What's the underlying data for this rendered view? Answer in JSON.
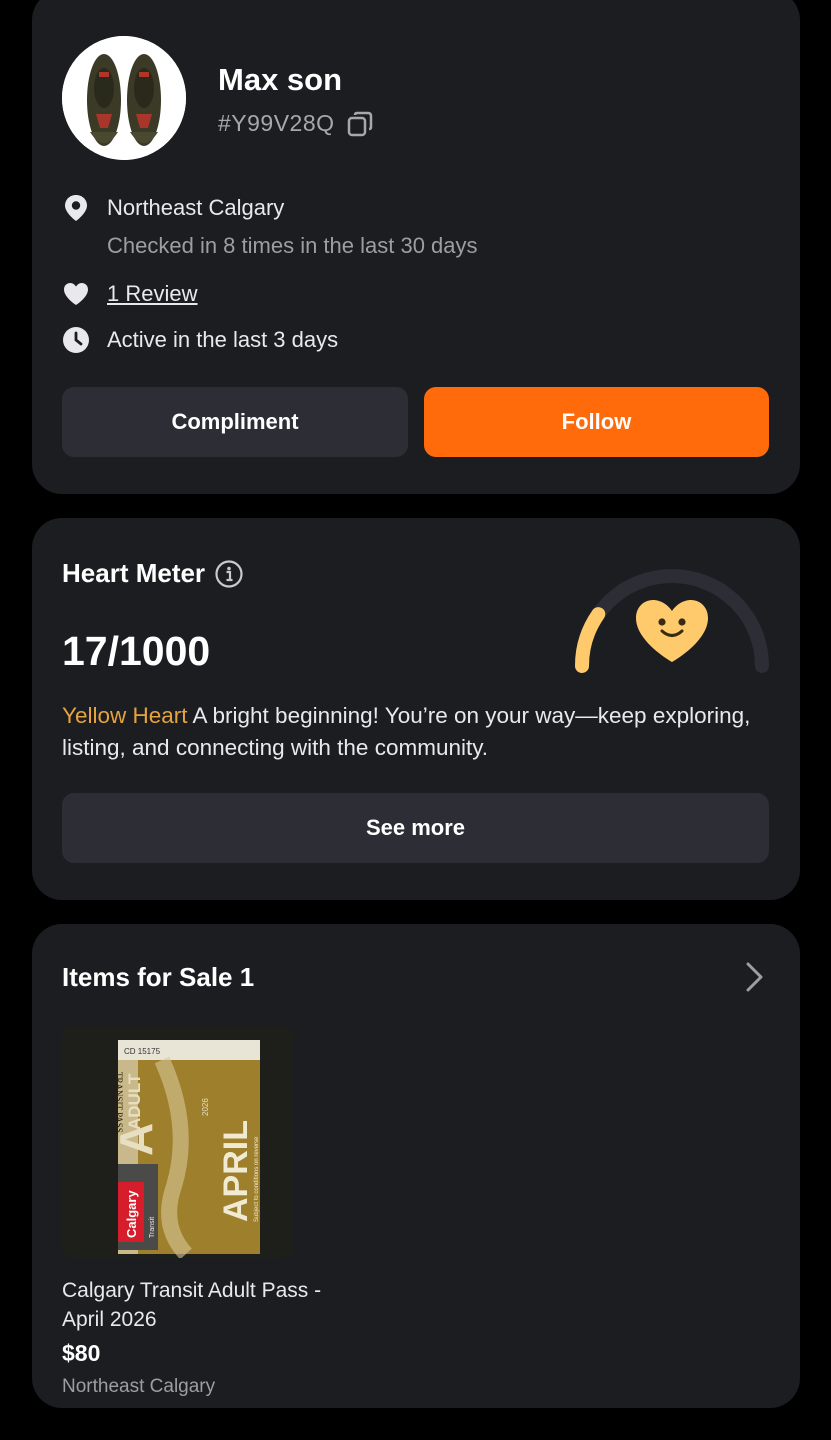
{
  "profile": {
    "name": "Max son",
    "user_id": "#Y99V28Q",
    "location": "Northeast Calgary",
    "checkins": "Checked in 8 times in the last 30 days",
    "reviews": "1 Review",
    "activity": "Active in the last 3 days",
    "compliment_label": "Compliment",
    "follow_label": "Follow",
    "avatar_icon": "sneakers-photo"
  },
  "heart_meter": {
    "title": "Heart Meter",
    "score": "17/1000",
    "progress": 0.017,
    "level": "Yellow Heart",
    "description": " A bright beginning! You’re on your way—keep exploring, listing, and connecting with the community.",
    "see_more_label": "See more"
  },
  "items_for_sale": {
    "title": "Items for Sale 1",
    "items": [
      {
        "title": "Calgary Transit Adult Pass - April 2026",
        "price": "$80",
        "location": "Northeast Calgary",
        "photo_text": {
          "serial": "CD 15175",
          "big_letter": "A",
          "adult": "ADULT",
          "transit_pass": "TRANSIT PASS",
          "month": "APRIL",
          "brand": "Calgary",
          "subtitle": "Transit",
          "conditions": "Subject to conditions on reverse",
          "year": "2026"
        }
      }
    ]
  },
  "colors": {
    "background": "#000000",
    "card": "#1c1d21",
    "button_dark": "#2c2d35",
    "accent_orange": "#ff6a0a",
    "heart_yellow": "#ffca6b",
    "level_text": "#e5a33e"
  }
}
